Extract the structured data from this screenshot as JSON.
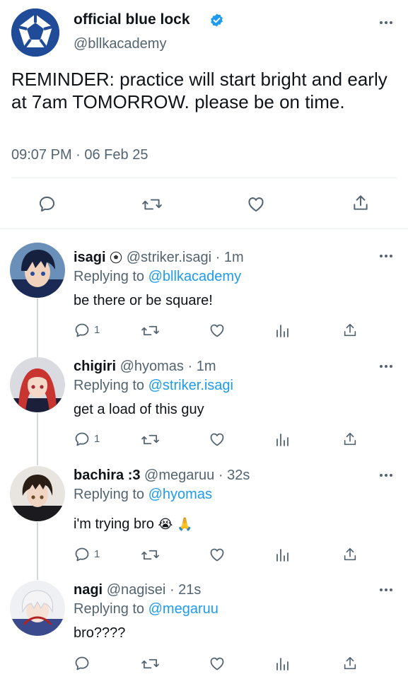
{
  "main_tweet": {
    "name": "official blue lock",
    "handle": "@bllkacademy",
    "text": "REMINDER: practice will start bright and early at 7am TOMORROW. please be on time.",
    "timestamp": "09:07 PM · 06 Feb 25",
    "verified": true
  },
  "replies": [
    {
      "name": "isagi",
      "name_emoji": "⚽",
      "handle": "@striker.isagi",
      "time": "· 1m",
      "replying_label": "Replying to",
      "replying_to": "@bllkacademy",
      "text": "be there or be square!",
      "reply_count": "1"
    },
    {
      "name": "chigiri",
      "handle": "@hyomas",
      "time": "· 1m",
      "replying_label": "Replying to",
      "replying_to": "@striker.isagi",
      "text": "get a load of this guy",
      "reply_count": "1"
    },
    {
      "name": "bachira :3",
      "handle": "@megaruu",
      "time": "· 32s",
      "replying_label": "Replying to",
      "replying_to": "@hyomas",
      "text": "i'm trying bro",
      "text_emoji": "😭 🙏",
      "reply_count": "1"
    },
    {
      "name": "nagi",
      "handle": "@nagisei",
      "time": "· 21s",
      "replying_label": "Replying to",
      "replying_to": "@megaruu",
      "text": "bro????",
      "reply_count": ""
    }
  ],
  "icons": [
    "reply-icon",
    "retweet-icon",
    "like-icon",
    "share-icon",
    "analytics-icon",
    "more-icon",
    "verified-icon"
  ],
  "colors": {
    "accent": "#1d9bf0",
    "muted": "#536471",
    "text": "#0f1419",
    "brand": "#1f4b99"
  }
}
